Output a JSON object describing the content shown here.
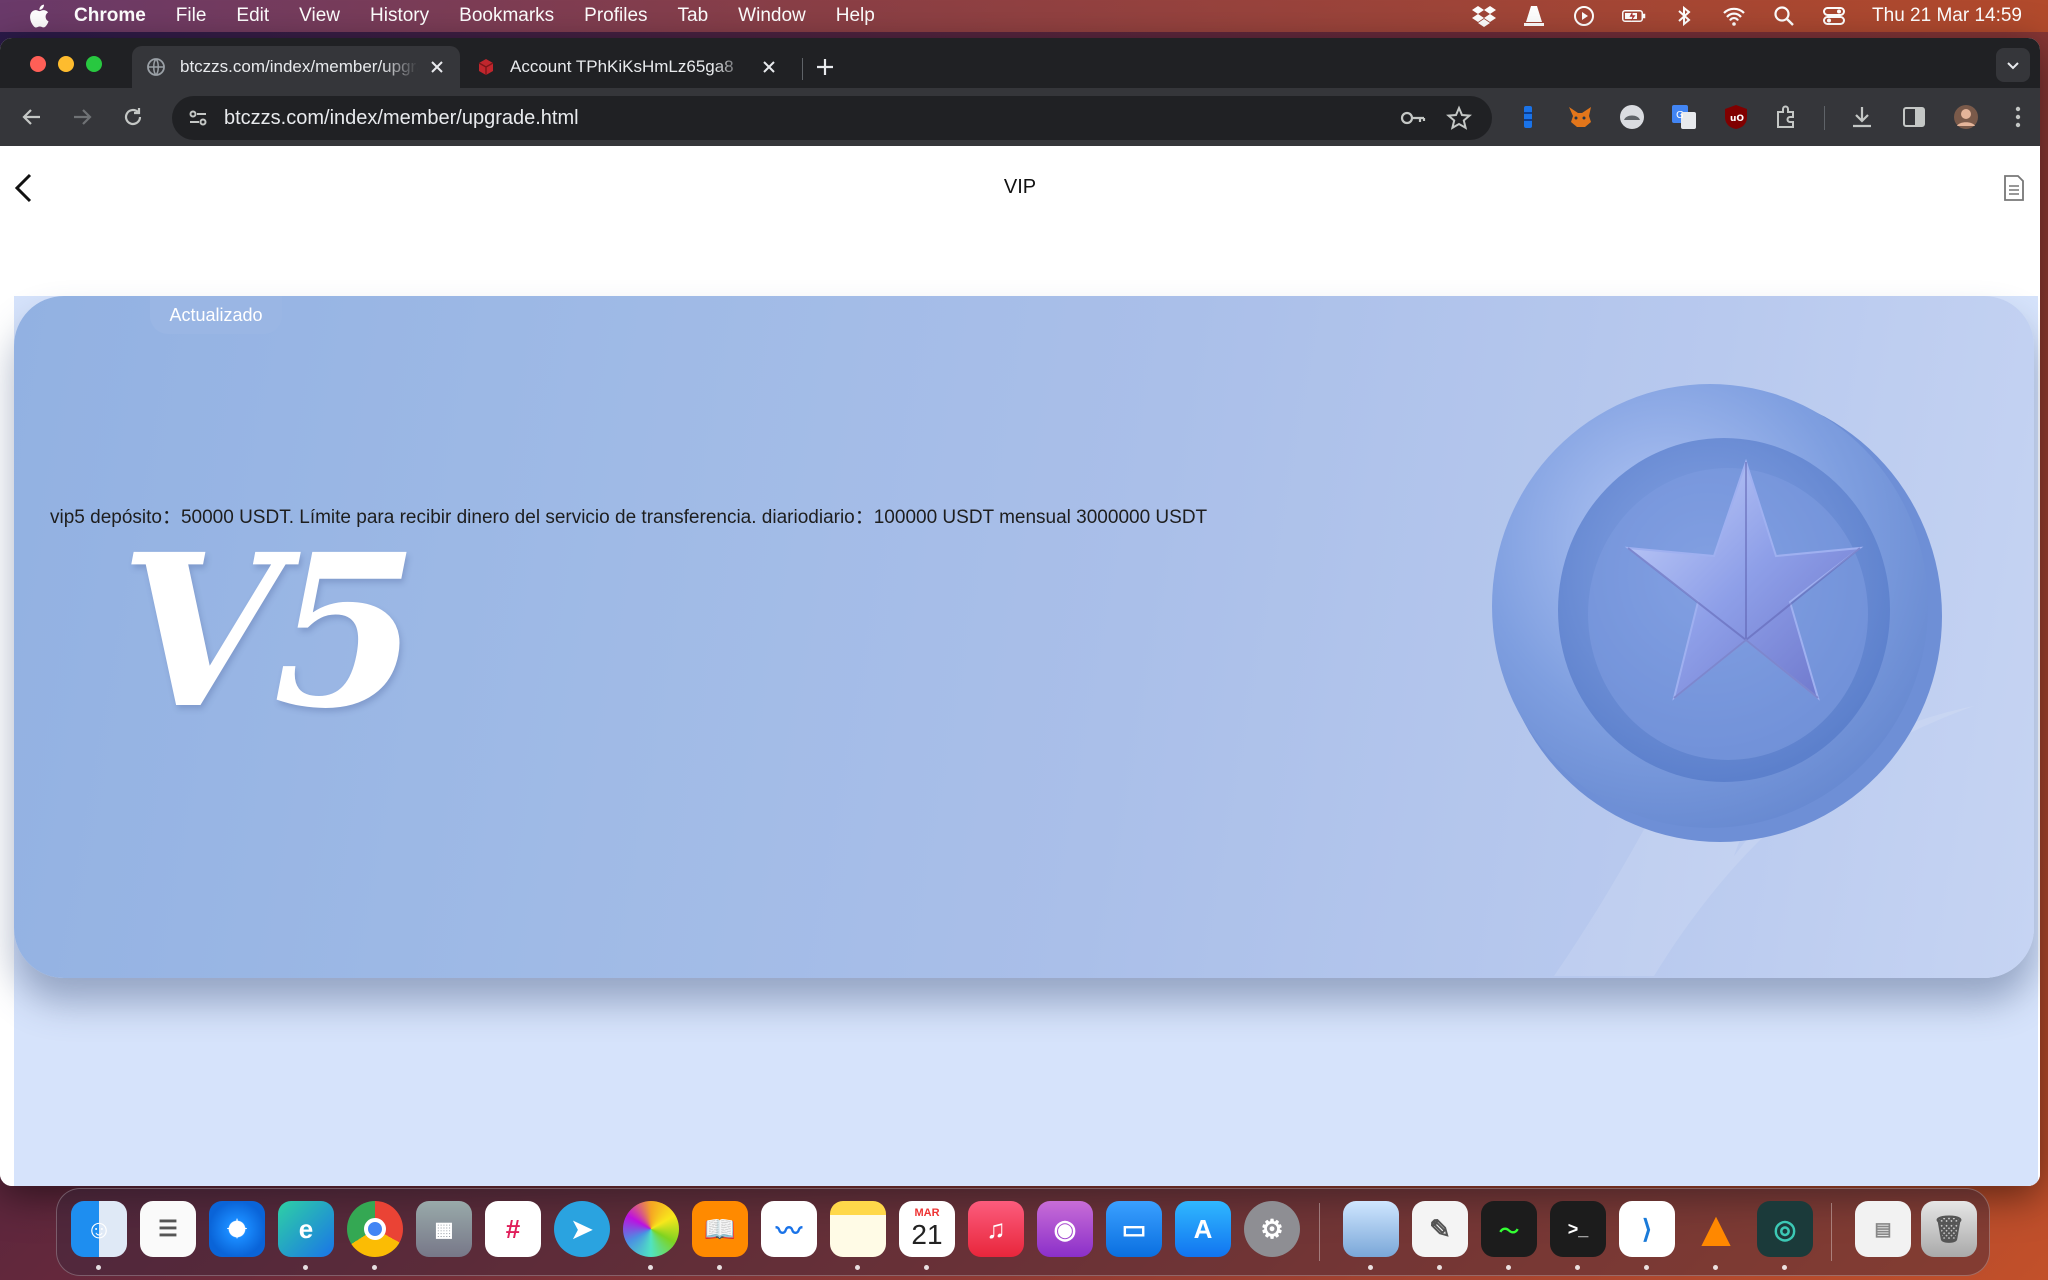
{
  "menubar": {
    "app_name": "Chrome",
    "items": [
      "File",
      "Edit",
      "View",
      "History",
      "Bookmarks",
      "Profiles",
      "Tab",
      "Window",
      "Help"
    ],
    "clock": "Thu 21 Mar  14:59",
    "status_icons": [
      "dropbox-icon",
      "vlc-icon",
      "play-icon",
      "battery-icon",
      "bluetooth-icon",
      "wifi-icon",
      "spotlight-icon",
      "control-center-icon"
    ]
  },
  "browser": {
    "tabs": [
      {
        "title": "btczzs.com/index/member/upgrade.html",
        "active": true
      },
      {
        "title": "Account TPhKiKsHmLz65ga8",
        "active": false
      }
    ],
    "url": "btczzs.com/index/member/upgrade.html"
  },
  "page": {
    "title": "VIP",
    "badge": "Actualizado",
    "description": "vip5 depósito：50000 USDT. Límite para recibir dinero del servicio de transferencia. diariodiario：100000 USDT mensual 3000000 USDT",
    "level_mark": "V5"
  },
  "dock": {
    "apps": [
      "Finder",
      "Reminders",
      "Safari",
      "Edge",
      "Chrome",
      "Launchpad",
      "Slack",
      "Telegram",
      "Photos",
      "Books",
      "Freeform",
      "Notes",
      "Calendar",
      "Music",
      "Podcasts",
      "Keynote",
      "App Store",
      "System Settings",
      "Preview",
      "TextEdit",
      "Activity Monitor",
      "Terminal",
      "VS Code",
      "VLC",
      "GitKraken",
      "Documents",
      "Trash"
    ],
    "calendar_month": "MAR",
    "calendar_day": "21"
  },
  "colors": {
    "card_blue": "#9fbae6",
    "page_bg": "#d6e3fb",
    "chrome_dark": "#202124",
    "chrome_toolbar": "#35363a"
  }
}
